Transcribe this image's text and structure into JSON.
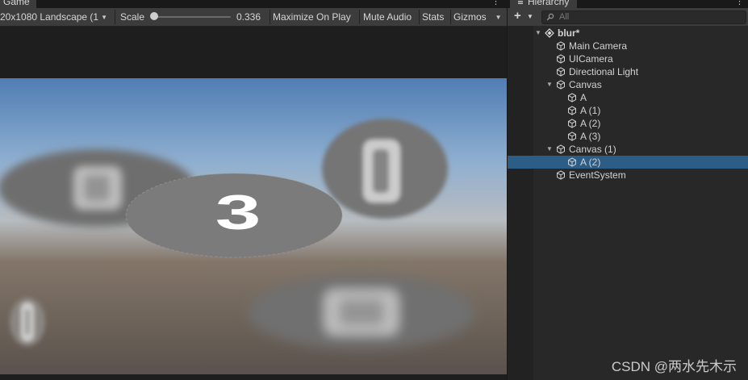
{
  "game": {
    "tab_label": "Game",
    "resolution_label": "20x1080 Landscape (1",
    "scale_label": "Scale",
    "scale_value": "0.336",
    "scale_fraction": 0.0,
    "maximize_label": "Maximize On Play",
    "mute_label": "Mute Audio",
    "stats_label": "Stats",
    "gizmos_label": "Gizmos",
    "center_image_label": "3"
  },
  "hierarchy": {
    "tab_label": "Hierarchy",
    "add_label": "+",
    "search_placeholder": "All",
    "items": [
      {
        "label": "blur*",
        "depth": 0,
        "expanded": true,
        "icon": "unity-scene-icon",
        "selected": false
      },
      {
        "label": "Main Camera",
        "depth": 1,
        "expanded": null,
        "icon": "gameobject-cube-icon",
        "selected": false
      },
      {
        "label": "UICamera",
        "depth": 1,
        "expanded": null,
        "icon": "gameobject-cube-icon",
        "selected": false
      },
      {
        "label": "Directional Light",
        "depth": 1,
        "expanded": null,
        "icon": "gameobject-cube-icon",
        "selected": false
      },
      {
        "label": "Canvas",
        "depth": 1,
        "expanded": true,
        "icon": "gameobject-cube-icon",
        "selected": false
      },
      {
        "label": "A",
        "depth": 2,
        "expanded": null,
        "icon": "gameobject-cube-icon",
        "selected": false
      },
      {
        "label": "A (1)",
        "depth": 2,
        "expanded": null,
        "icon": "gameobject-cube-icon",
        "selected": false
      },
      {
        "label": "A (2)",
        "depth": 2,
        "expanded": null,
        "icon": "gameobject-cube-icon",
        "selected": false
      },
      {
        "label": "A (3)",
        "depth": 2,
        "expanded": null,
        "icon": "gameobject-cube-icon",
        "selected": false
      },
      {
        "label": "Canvas (1)",
        "depth": 1,
        "expanded": true,
        "icon": "gameobject-cube-icon",
        "selected": false
      },
      {
        "label": "A (2)",
        "depth": 2,
        "expanded": null,
        "icon": "gameobject-cube-icon",
        "selected": true
      },
      {
        "label": "EventSystem",
        "depth": 1,
        "expanded": null,
        "icon": "gameobject-cube-icon",
        "selected": false
      }
    ]
  },
  "watermark": "CSDN @两水先木示",
  "colors": {
    "selection": "#2c5d87",
    "panel": "#282828",
    "toolbar": "#3c3c3c",
    "sky_top": "#4f7db4",
    "ground": "#5e5650"
  }
}
